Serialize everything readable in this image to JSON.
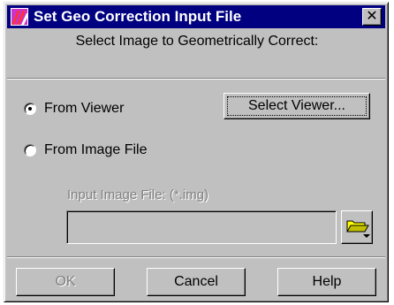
{
  "window": {
    "title": "Set Geo Correction Input File",
    "close_label": "✕"
  },
  "instruction": "Select Image to Geometrically Correct:",
  "source": {
    "from_viewer_label": "From Viewer",
    "from_viewer_checked": true,
    "from_image_file_label": "From Image File",
    "from_image_file_checked": false,
    "select_viewer_label": "Select Viewer..."
  },
  "input_file": {
    "label": "Input Image File: (*.img)",
    "value": "",
    "browse_icon": "folder-open-icon"
  },
  "buttons": {
    "ok_label": "OK",
    "ok_enabled": false,
    "cancel_label": "Cancel",
    "help_label": "Help"
  },
  "colors": {
    "titlebar": "#000080",
    "face": "#c0c0c0",
    "disabled_text": "#808080",
    "folder_yellow": "#ffff00"
  }
}
